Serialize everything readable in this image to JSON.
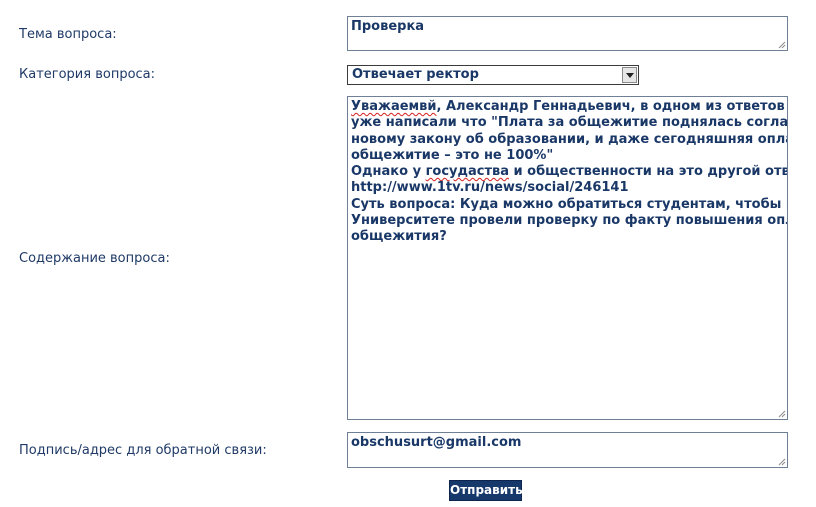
{
  "form": {
    "topic": {
      "label": "Тема вопроса:",
      "value": "Проверка"
    },
    "category": {
      "label": "Категория вопроса:",
      "selected": "Отвечает ректор"
    },
    "content": {
      "label": "Содержание вопроса:",
      "first_word": "Уважаемвй",
      "line1_rest": ", Александр Геннадьевич, в одном из ответов Вы",
      "lines": [
        "уже написали что \"Плата за общежитие поднялась согласно",
        "новому закону об образовании, и даже сегодняшняя оплата за",
        "общежитие – это не 100%\""
      ],
      "line5_prefix": "Однако у ",
      "line5_misspelled": "госудаства",
      "line5_rest": " и общественности на это другой ответ",
      "url_line": "http://www.1tv.ru/news/social/246141",
      "tail_lines": [
        "Суть вопроса: Куда можно обратиться студентам, чтобы в",
        "Университете провели проверку по факту повышения оплаты",
        "общежития?"
      ]
    },
    "contact": {
      "label": "Подпись/адрес для обратной связи:",
      "value": "obschusurt@gmail.com"
    },
    "submit_label": "Отправить"
  },
  "colors": {
    "label_text": "#1f3a66",
    "field_text": "#1a3867",
    "button_bg": "#17386b",
    "spellcheck": "#d81f1f"
  }
}
